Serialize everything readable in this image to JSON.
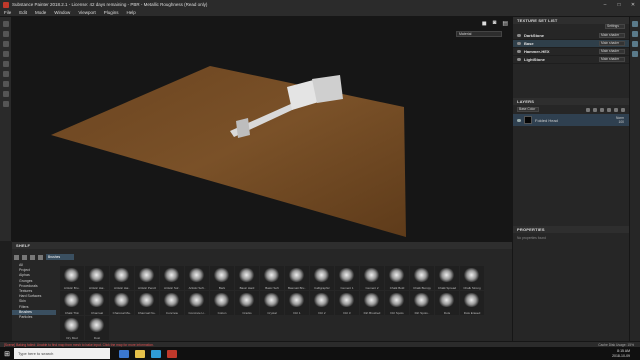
{
  "window": {
    "title": "Substance Painter 2018.2.1 - License: 42 days remaining - PBR - Metallic Roughness (Read only)"
  },
  "menu": [
    "File",
    "Edit",
    "Mode",
    "Window",
    "Viewport",
    "Plugins",
    "Help"
  ],
  "viewport": {
    "material_mode": "Material"
  },
  "texture_set_list": {
    "title": "TEXTURE SET LIST",
    "settings_label": "Settings",
    "items": [
      {
        "name": "DarkStone",
        "shader": "Main shader"
      },
      {
        "name": "Base",
        "shader": "Main shader"
      },
      {
        "name": "Hammer-HEX",
        "shader": "Main shader"
      },
      {
        "name": "LightStone",
        "shader": "Main shader"
      }
    ]
  },
  "layers": {
    "title": "LAYERS",
    "blend_mode": "Base Color",
    "layer_name": "Folded Head",
    "layer_blend": "Norm",
    "layer_opacity": "100"
  },
  "properties": {
    "title": "PROPERTIES",
    "empty": "No properties found"
  },
  "shelf": {
    "title": "SHELF",
    "search_tag": "Brushes",
    "categories": [
      "All",
      "Project",
      "Alphas",
      "Grunges",
      "Procedurals",
      "Textures",
      "Hard Surfaces",
      "Skin",
      "Filters",
      "Brushes",
      "Particles"
    ],
    "selected_category": "Brushes",
    "brushes": [
      "Artistic Bru..",
      "Artistic Hai..",
      "Artistic Hai..",
      "Artistic Pencil",
      "Artistic Sof..",
      "Artistic Soft..",
      "Bark",
      "Basic Hard",
      "Basic Soft",
      "Basmati Bru..",
      "Calligraphic",
      "Cement 1",
      "Cement 2",
      "Chalk Bold",
      "Chalk Bumpy",
      "Chalk Spread",
      "Chalk Strong",
      "Chalk Thin",
      "Charcoal",
      "Charcoal Ma..",
      "Charcoal No..",
      "Concrete",
      "Concrete Li..",
      "Cotton",
      "Cracks",
      "Crystal",
      "Dirt 1",
      "Dirt 2",
      "Dirt 3",
      "Dirt Brushed",
      "Dirt Spots",
      "Dirt Spots..",
      "Dots",
      "Dots Erased",
      "Dry Mud",
      "Dust"
    ]
  },
  "status": {
    "message": "[Scene] Baking failed: Unable to find map from mesh to bake input. Click the map for more information.",
    "cache": "Cache Disk Usage: 15%"
  },
  "taskbar": {
    "search_placeholder": "Type here to search",
    "time": "8:15 AM",
    "date": "2018-10-09",
    "lang": "ENG"
  }
}
